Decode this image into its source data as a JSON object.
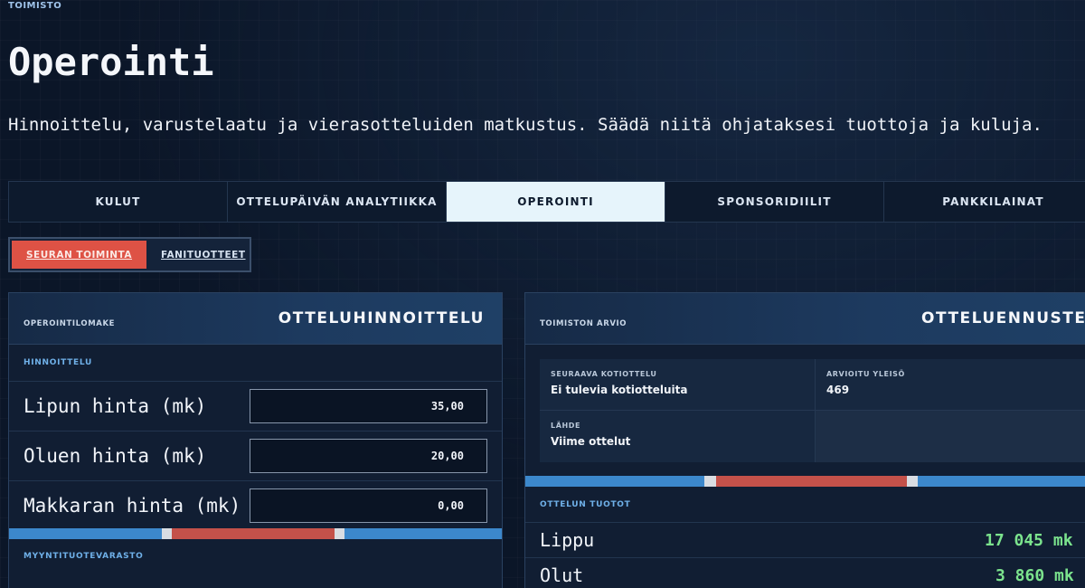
{
  "header": {
    "eyebrow": "TOIMISTO",
    "title": "Operointi",
    "description": "Hinnoittelu, varustelaatu ja vierasotteluiden matkustus. Säädä niitä ohjataksesi tuottoja ja kuluja."
  },
  "tabs": [
    {
      "label": "KULUT",
      "active": false
    },
    {
      "label": "OTTELUPÄIVÄN ANALYTIIKKA",
      "active": false
    },
    {
      "label": "OPEROINTI",
      "active": true
    },
    {
      "label": "SPONSORIDIILIT",
      "active": false
    },
    {
      "label": "PANKKILAINAT",
      "active": false
    }
  ],
  "subtabs": [
    {
      "label": "SEURAN TOIMINTA",
      "active": true
    },
    {
      "label": "FANITUOTTEET",
      "active": false
    }
  ],
  "pricing_panel": {
    "kicker": "OPEROINTILOMAKE",
    "heading": "OTTELUHINNOITTELU",
    "section": "HINNOITTELU",
    "fields": [
      {
        "label": "Lipun hinta (mk)",
        "value": "35,00"
      },
      {
        "label": "Oluen hinta (mk)",
        "value": "20,00"
      },
      {
        "label": "Makkaran hinta (mk)",
        "value": "0,00"
      }
    ],
    "next_section": "MYYNTITUOTEVARASTO"
  },
  "forecast_panel": {
    "kicker": "TOIMISTON ARVIO",
    "heading": "OTTELUENNUSTE",
    "info": {
      "next_match_label": "SEURAAVA KOTIOTTELU",
      "next_match_value": "Ei tulevia kotiotteluita",
      "attendance_label": "ARVIOITU YLEISÖ",
      "attendance_value": "469",
      "source_label": "LÄHDE",
      "source_value": "Viime ottelut"
    },
    "revenue_section": "OTTELUN TUOTOT",
    "revenues": [
      {
        "label": "Lippu",
        "value": "17 045 mk"
      },
      {
        "label": "Olut",
        "value": "3 860 mk"
      }
    ]
  },
  "colors": {
    "accent_red": "#de5245",
    "accent_blue": "#3c88cc",
    "positive_green": "#7be38d",
    "active_tab_bg": "#e6f4fb"
  }
}
